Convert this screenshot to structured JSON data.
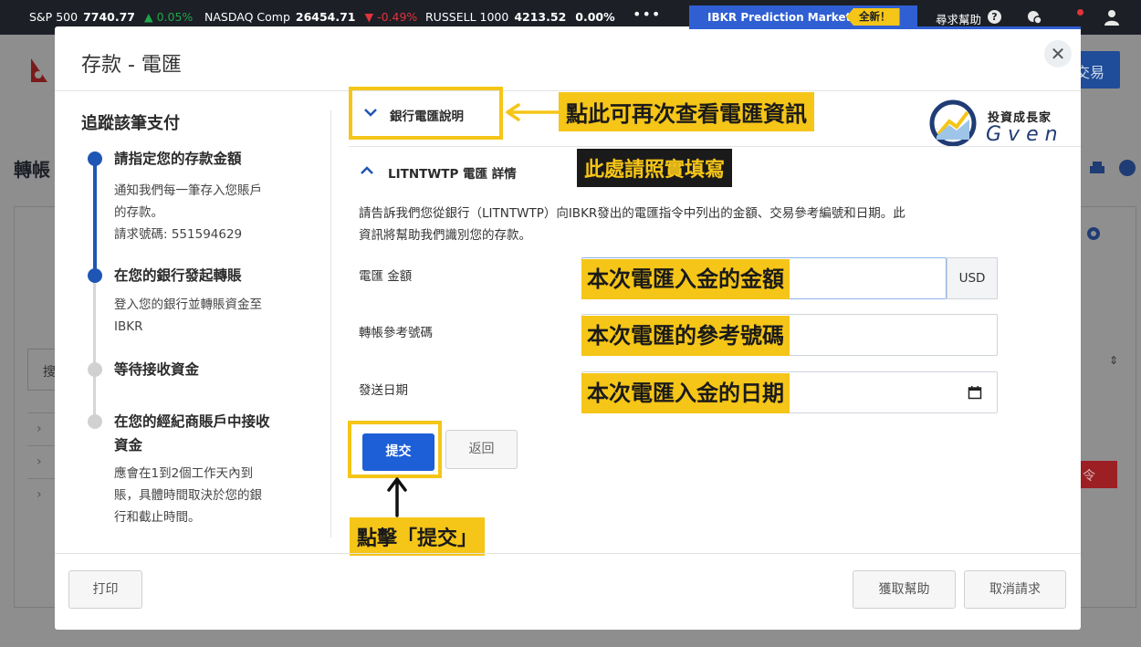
{
  "ticker": [
    {
      "name": "S&P 500",
      "value": "7740.77",
      "change": "▲ 0.05%",
      "dir": "up"
    },
    {
      "name": "NASDAQ Comp",
      "value": "26454.71",
      "change": "▼ -0.49%",
      "dir": "down"
    },
    {
      "name": "RUSSELL 1000",
      "value": "4213.52",
      "change": "0.00%",
      "dir": "flat"
    }
  ],
  "topbar": {
    "more": "•••",
    "prediction_label": "IBKR Prediction Markets",
    "new_badge": "全新！",
    "help_label": "尋求幫助",
    "help_q": "?"
  },
  "background": {
    "page_title": "轉帳",
    "right_button": "交易",
    "search_stub": "搜",
    "red_button_stub": "令"
  },
  "modal": {
    "title": "存款 - 電匯",
    "close": "✕",
    "steps_heading": "追蹤該筆支付",
    "steps": [
      {
        "title": "請指定您的存款金額",
        "desc_lines": [
          "通知我們每一筆存入您賬戶",
          "的存款。",
          "請求號碼: 551594629"
        ],
        "state": "done"
      },
      {
        "title": "在您的銀行發起轉賬",
        "desc_lines": [
          "登入您的銀行並轉賬資金至",
          "IBKR"
        ],
        "state": "current"
      },
      {
        "title": "等待接收資金",
        "desc_lines": [],
        "state": "pending"
      },
      {
        "title_lines": [
          "在您的經紀商賬戶中接收",
          "資金"
        ],
        "desc_lines": [
          "應會在1到2個工作天內到",
          "賬，具體時間取決於您的銀",
          "行和截止時間。"
        ],
        "state": "pending"
      }
    ],
    "accordion_wire_info": "銀行電匯說明",
    "accordion_details": "LITNTWTP 電匯 詳情",
    "description_lines": [
      "請告訴我們您從銀行（LITNTWTP）向IBKR發出的電匯指令中列出的金額、交易參考編號和日期。此",
      "資訊將幫助我們識別您的存款。"
    ],
    "fields": {
      "amount_label": "電匯 金額",
      "currency": "USD",
      "reference_label": "轉帳參考號碼",
      "date_label": "發送日期"
    },
    "submit_label": "提交",
    "back_label": "返回",
    "footer": {
      "print": "打印",
      "get_help": "獲取幫助",
      "cancel": "取消請求"
    }
  },
  "annotations": {
    "view_again": "點此可再次查看電匯資訊",
    "fill_actual": "此處請照實填寫",
    "amount_hint": "本次電匯入金的金額",
    "reference_hint": "本次電匯的參考號碼",
    "date_hint": "本次電匯入金的日期",
    "click_submit": "點擊「提交」"
  },
  "brand": {
    "cn": "投資成長家",
    "en": "Gven"
  },
  "colors": {
    "accent_blue": "#1f56b5",
    "button_blue": "#1d5fd6",
    "highlight_yellow": "#f5c518",
    "ticker_up": "#1fa64a",
    "ticker_down": "#e0343a"
  }
}
